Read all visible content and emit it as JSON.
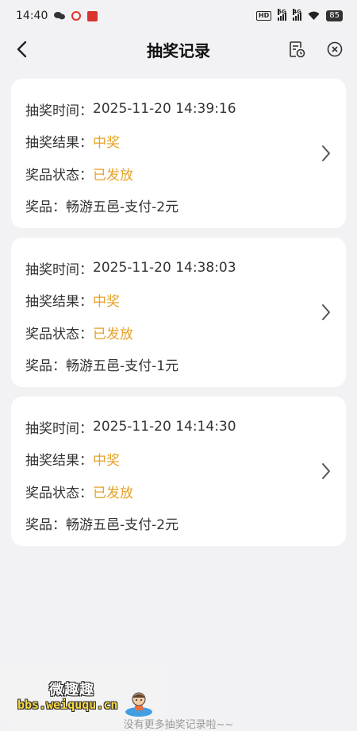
{
  "status_bar": {
    "time": "14:40",
    "hd_label": "HD",
    "net1": "5G",
    "net2": "4G",
    "battery": "85"
  },
  "nav": {
    "title": "抽奖记录"
  },
  "records": [
    {
      "time_label": "抽奖时间：",
      "time": "2025-11-20 14:39:16",
      "result_label": "抽奖结果：",
      "result": "中奖",
      "status_label": "奖品状态：",
      "status": "已发放",
      "prize_label": "奖品：",
      "prize": "畅游五邑-支付-2元"
    },
    {
      "time_label": "抽奖时间：",
      "time": "2025-11-20 14:38:03",
      "result_label": "抽奖结果：",
      "result": "中奖",
      "status_label": "奖品状态：",
      "status": "已发放",
      "prize_label": "奖品：",
      "prize": "畅游五邑-支付-1元"
    },
    {
      "time_label": "抽奖时间：",
      "time": "2025-11-20 14:14:30",
      "result_label": "抽奖结果：",
      "result": "中奖",
      "status_label": "奖品状态：",
      "status": "已发放",
      "prize_label": "奖品：",
      "prize": "畅游五邑-支付-2元"
    }
  ],
  "footer": {
    "no_more": "没有更多抽奖记录啦~~"
  },
  "watermark": {
    "title": "微趣趣",
    "url": "bbs.weiququ.cn"
  },
  "colors": {
    "accent": "#e6a229",
    "background": "#f2f2f4"
  }
}
